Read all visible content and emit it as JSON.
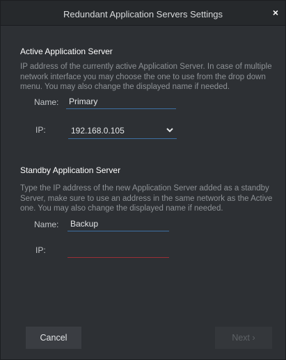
{
  "dialog": {
    "title": "Redundant Application Servers Settings",
    "close_glyph": "×"
  },
  "active": {
    "heading": "Active Application Server",
    "description": "IP address of the currently active Application Server. In case of multiple network interface you may choose the one to use from the drop down menu. You may also change the displayed name if needed.",
    "name_label": "Name:",
    "name_value": "Primary",
    "ip_label": "IP:",
    "ip_value": "192.168.0.105"
  },
  "standby": {
    "heading": "Standby Application Server",
    "description": "Type the IP address of the new Application Server added as a standby Server, make sure to use an address in the same network as the Active one. You may also change the displayed name if needed.",
    "name_label": "Name:",
    "name_value": "Backup",
    "ip_label": "IP:",
    "ip_value": ""
  },
  "footer": {
    "cancel_label": "Cancel",
    "next_label": "Next ›"
  },
  "colors": {
    "accent_underline": "#3d6fa3",
    "error_underline": "#9c2f36"
  }
}
